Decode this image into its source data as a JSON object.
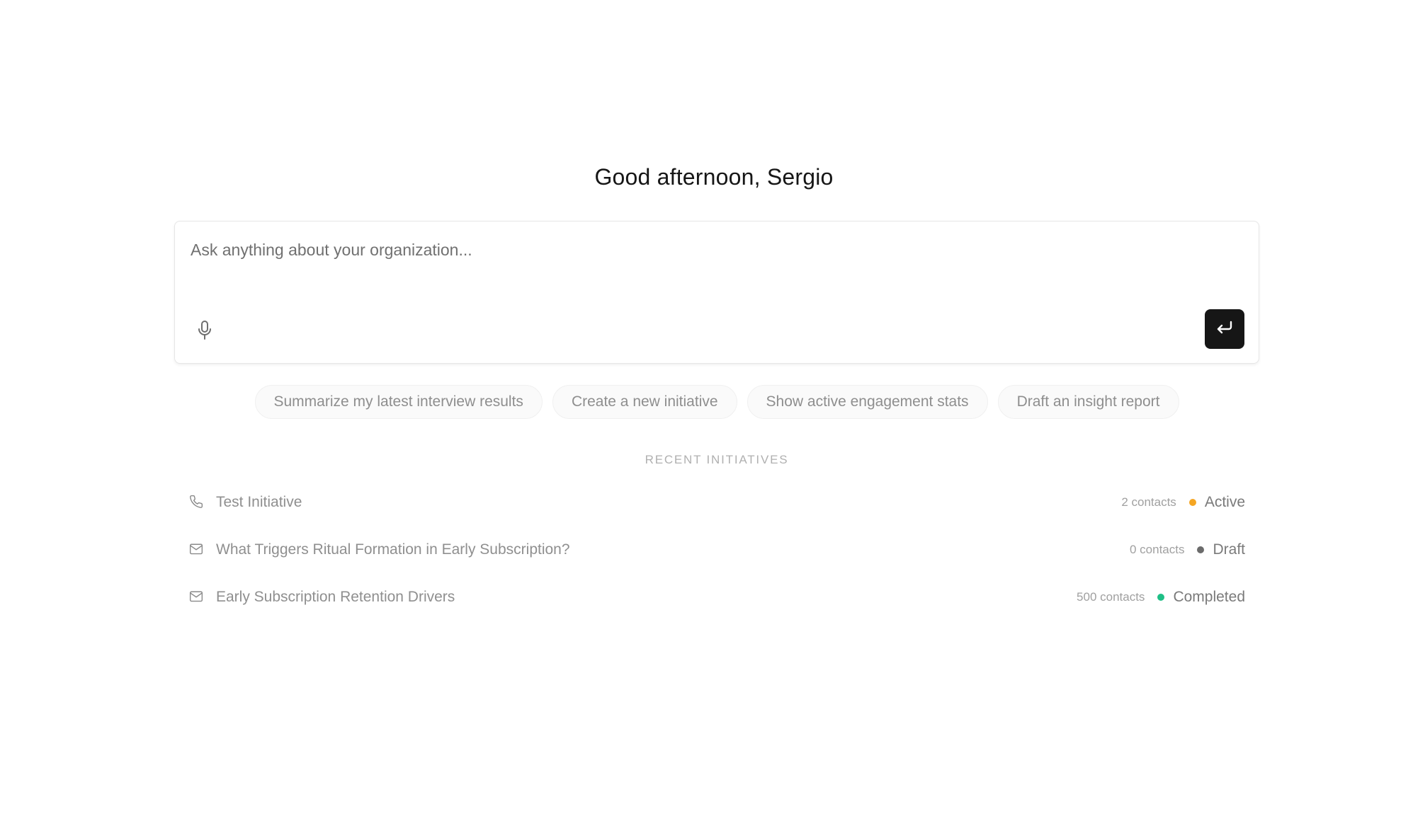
{
  "greeting": "Good afternoon, Sergio",
  "prompt": {
    "placeholder": "Ask anything about your organization...",
    "value": "",
    "mic_icon": "microphone-icon",
    "send_icon": "enter-return-icon"
  },
  "suggestions": [
    {
      "label": "Summarize my latest interview results"
    },
    {
      "label": "Create a new initiative"
    },
    {
      "label": "Show active engagement stats"
    },
    {
      "label": "Draft an insight report"
    }
  ],
  "recent": {
    "title": "RECENT INITIATIVES",
    "items": [
      {
        "icon": "phone-icon",
        "title": "Test Initiative",
        "contacts": "2 contacts",
        "status": "Active",
        "status_color": "#f5a623"
      },
      {
        "icon": "mail-icon",
        "title": "What Triggers Ritual Formation in Early Subscription?",
        "contacts": "0 contacts",
        "status": "Draft",
        "status_color": "#6b6b6b"
      },
      {
        "icon": "mail-icon",
        "title": "Early Subscription Retention Drivers",
        "contacts": "500 contacts",
        "status": "Completed",
        "status_color": "#1fbf86"
      }
    ]
  }
}
